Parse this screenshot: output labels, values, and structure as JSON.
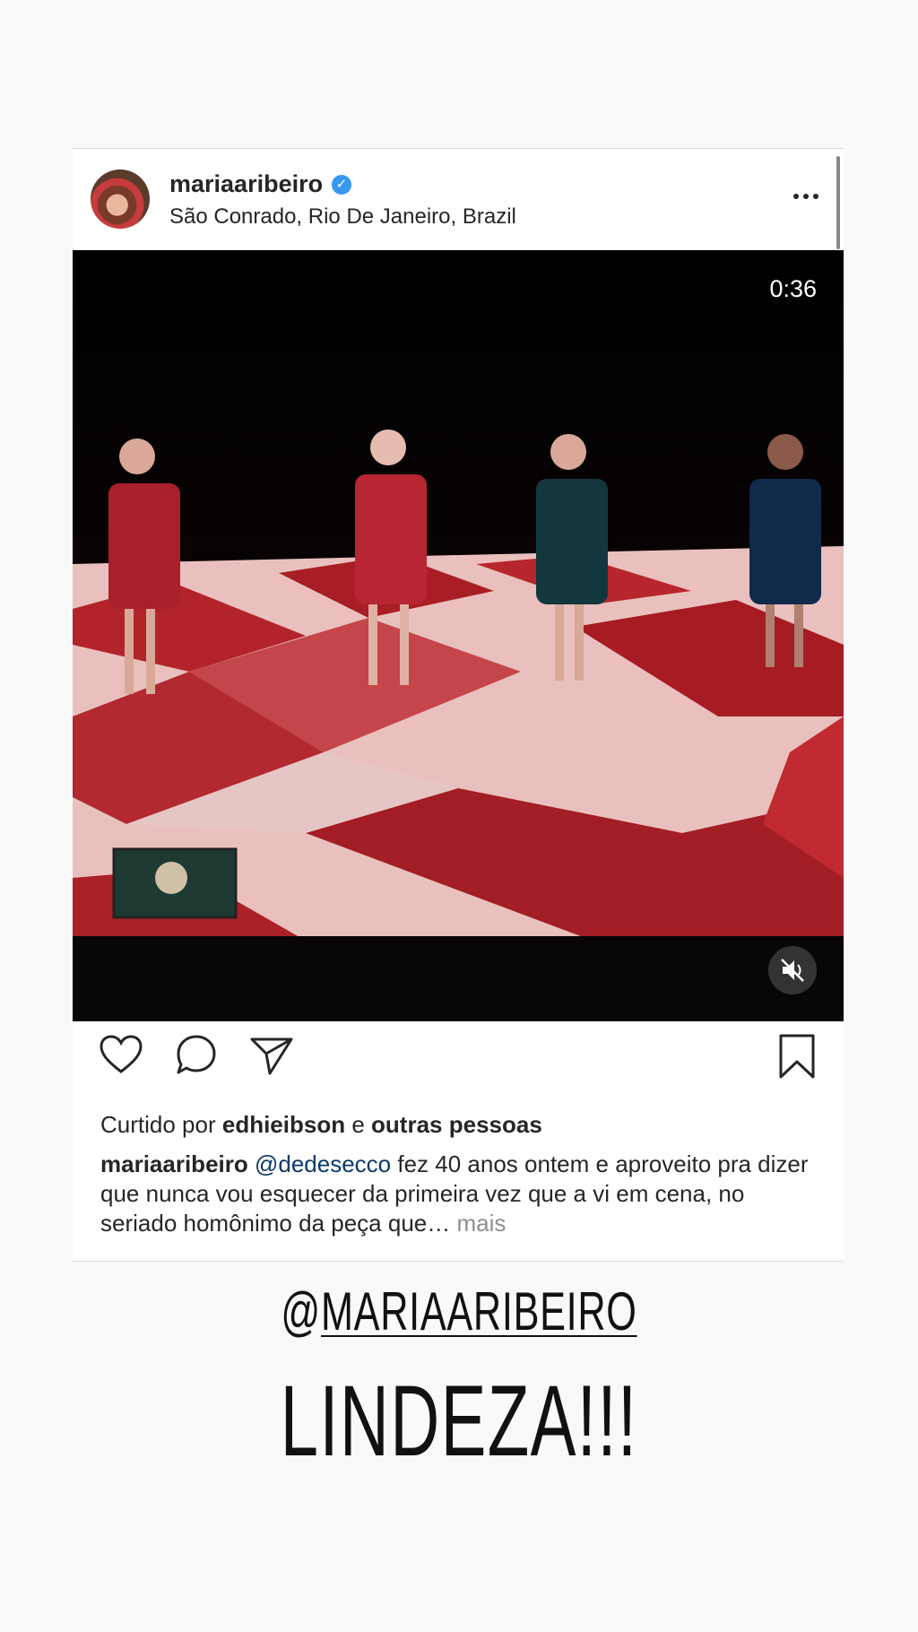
{
  "post": {
    "username": "mariaaribeiro",
    "verified": true,
    "location": "São Conrado, Rio De Janeiro, Brazil",
    "video_time": "0:36",
    "likes": {
      "prefix": "Curtido por",
      "user": "edhieibson",
      "connector": "e",
      "others": "outras pessoas"
    },
    "caption": {
      "user": "mariaaribeiro",
      "mention": "@dedesecco",
      "text": "fez 40 anos ontem e aproveito pra dizer que nunca vou esquecer da primeira vez que a vi em cena, no seriado homônimo da peça que…",
      "more": "mais"
    }
  },
  "story": {
    "mention_at": "@",
    "mention_name": "MARIAARIBEIRO",
    "text": "LINDEZA!!!"
  },
  "icons": {
    "more": "more-options-icon",
    "like": "heart-icon",
    "comment": "comment-icon",
    "share": "send-icon",
    "save": "bookmark-icon",
    "mute": "muted-speaker-icon",
    "verified": "verified-badge-icon"
  },
  "colors": {
    "verified": "#3897f0",
    "mention": "#0a3a69",
    "muted_text": "#8e8e8e"
  }
}
